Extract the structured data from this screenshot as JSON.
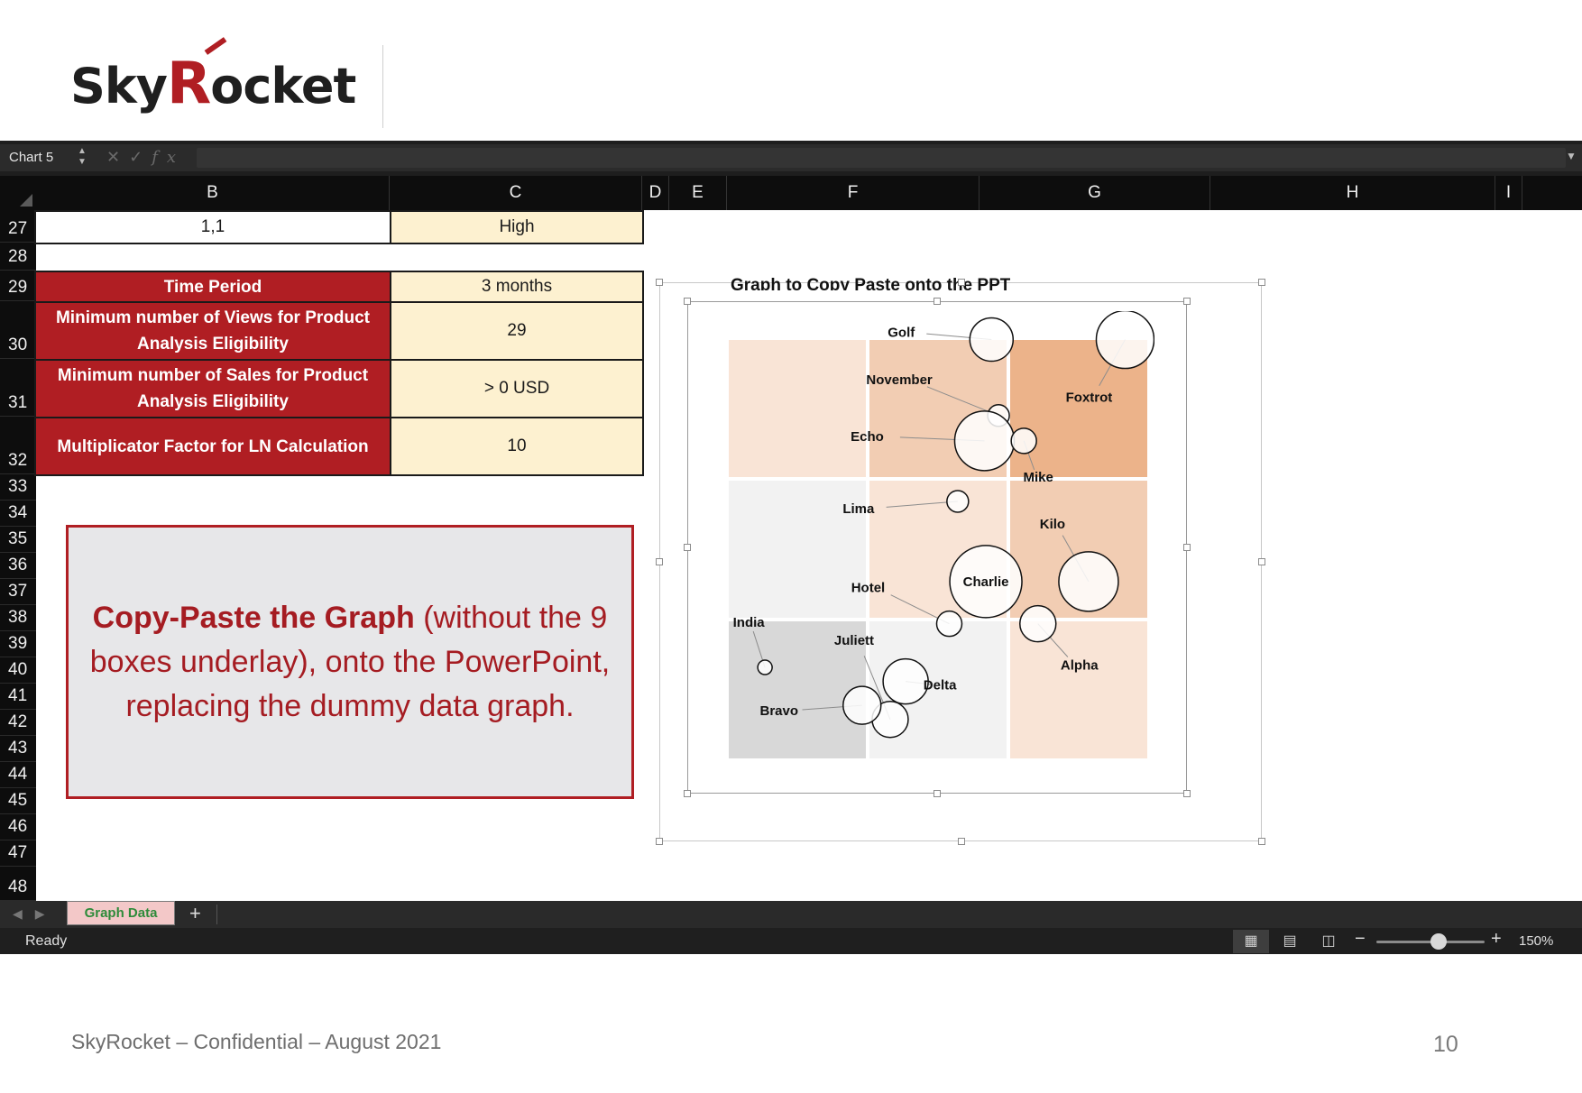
{
  "logo": {
    "text_a": "Sky",
    "text_r": "R",
    "text_b": "ocket"
  },
  "formula_bar": {
    "name_box": "Chart 5",
    "fx_symbol": "fx",
    "formula": ""
  },
  "columns": [
    "B",
    "C",
    "D",
    "E",
    "F",
    "G",
    "H",
    "I"
  ],
  "rows": [
    "27",
    "28",
    "29",
    "30",
    "31",
    "32",
    "33",
    "34",
    "35",
    "36",
    "37",
    "38",
    "39",
    "40",
    "41",
    "42",
    "43",
    "44",
    "45",
    "46",
    "47",
    "48"
  ],
  "cells": {
    "r27_b": "1,1",
    "r27_c": "High",
    "r29_b": "Time Period",
    "r29_c": "3 months",
    "r30_b": "Minimum number of Views for Product Analysis Eligibility",
    "r30_c": "29",
    "r31_b": "Minimum number of Sales for Product Analysis Eligibility",
    "r31_c": "> 0 USD",
    "r32_b": "Multiplicator Factor for LN Calculation",
    "r32_c": "10"
  },
  "note": {
    "bold": "Copy-Paste the Graph",
    "rest": " (without the 9 boxes underlay), onto the PowerPoint, replacing the dummy data graph."
  },
  "chart": {
    "title": "Graph to Copy Paste onto the PPT"
  },
  "chart_data": {
    "type": "scatter",
    "title": "Graph to Copy Paste onto the PPT",
    "xlabel": "",
    "ylabel": "",
    "grid_fills": [
      [
        "#f9e4d6",
        "#f2cdb3",
        "#ecb38a"
      ],
      [
        "#f2f2f2",
        "#f9e4d6",
        "#f2cdb3"
      ],
      [
        "#d8d8d8",
        "#f2f2f2",
        "#f9e4d6"
      ]
    ],
    "points": [
      {
        "label": "Golf",
        "x": 1.88,
        "y": 2.99,
        "size": 24
      },
      {
        "label": "Foxtrot",
        "x": 2.83,
        "y": 2.99,
        "size": 32
      },
      {
        "label": "November",
        "x": 1.93,
        "y": 2.45,
        "size": 12
      },
      {
        "label": "Echo",
        "x": 1.83,
        "y": 2.27,
        "size": 33
      },
      {
        "label": "Mike",
        "x": 2.11,
        "y": 2.27,
        "size": 14
      },
      {
        "label": "Lima",
        "x": 1.64,
        "y": 1.84,
        "size": 12
      },
      {
        "label": "Kilo",
        "x": 2.57,
        "y": 1.27,
        "size": 33
      },
      {
        "label": "Charlie",
        "x": 1.84,
        "y": 1.27,
        "size": 40
      },
      {
        "label": "Hotel",
        "x": 1.58,
        "y": 0.97,
        "size": 14
      },
      {
        "label": "Alpha",
        "x": 2.21,
        "y": 0.97,
        "size": 20
      },
      {
        "label": "India",
        "x": 0.27,
        "y": 0.66,
        "size": 8
      },
      {
        "label": "Delta",
        "x": 1.27,
        "y": 0.56,
        "size": 25
      },
      {
        "label": "Juliett",
        "x": 1.16,
        "y": 0.29,
        "size": 20
      },
      {
        "label": "Bravo",
        "x": 0.96,
        "y": 0.39,
        "size": 21
      }
    ],
    "xlim": [
      0,
      3
    ],
    "ylim": [
      0,
      3
    ]
  },
  "sheet_tabs": {
    "active": "Graph Data",
    "add": "+"
  },
  "status": {
    "ready": "Ready",
    "zoom": "150%",
    "minus": "−",
    "plus": "+"
  },
  "footer": {
    "text": "SkyRocket – Confidential – August 2021",
    "page": "10"
  }
}
